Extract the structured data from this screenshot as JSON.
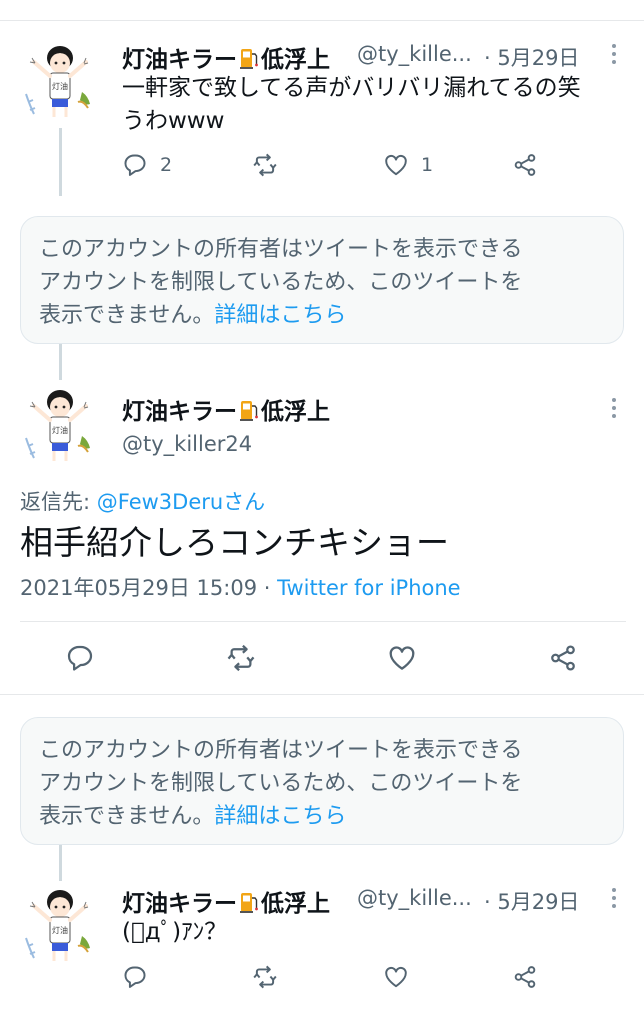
{
  "user": {
    "display_name": "灯油キラー",
    "display_name_suffix": "低浮上",
    "handle_truncated": "@ty_kille...",
    "handle_full": "@ty_killer24"
  },
  "tweet1": {
    "date": "· 5月29日",
    "text_line1": "一軒家で致してる声がバリバリ漏れてるの笑",
    "text_line2": "うわwww",
    "reply_count": "2",
    "like_count": "1"
  },
  "notice": {
    "line1": "このアカウントの所有者はツイートを表示できる",
    "line2": "アカウントを制限しているため、このツイートを",
    "line3": "表示できません。",
    "link": "詳細はこちら"
  },
  "main_tweet": {
    "reply_to_prefix": "返信先: ",
    "reply_to_handle": "@Few3Deruさん",
    "text": "相手紹介しろコンチキショー",
    "timestamp": "2021年05月29日 15:09 · ",
    "source": "Twitter for iPhone"
  },
  "tweet3": {
    "date": "· 5月29日",
    "text": "(ﾟдﾟ)ｱﾝ？"
  },
  "icons": [
    "reply-icon",
    "retweet-icon",
    "like-icon",
    "share-icon",
    "more-icon",
    "fuel-pump-icon"
  ],
  "colors": {
    "link": "#1d9bf0",
    "secondary": "#536471",
    "card_bg": "#f7f9f9"
  }
}
